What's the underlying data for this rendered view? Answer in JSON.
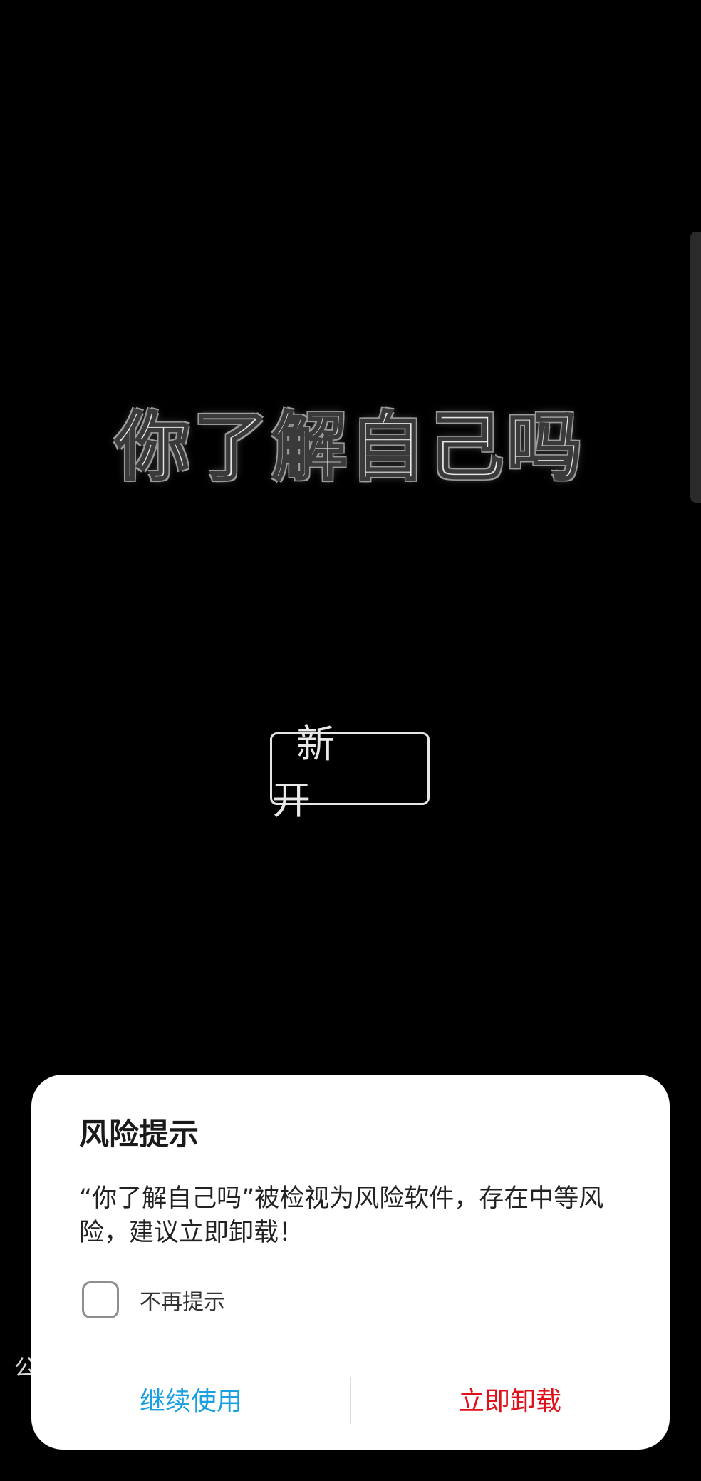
{
  "game": {
    "title": "你了解自己吗",
    "start_button_label": "新 开"
  },
  "background_peek_text": "公",
  "dialog": {
    "title": "风险提示",
    "message": "“你了解自己吗”被检视为风险软件，存在中等风险，建议立即卸载！",
    "checkbox_label": "不再提示",
    "checkbox_checked": false,
    "continue_label": "继续使用",
    "uninstall_label": "立即卸载"
  },
  "colors": {
    "background": "#000000",
    "dialog_background": "#ffffff",
    "continue_color": "#1aa0e0",
    "uninstall_color": "#e0101a"
  }
}
